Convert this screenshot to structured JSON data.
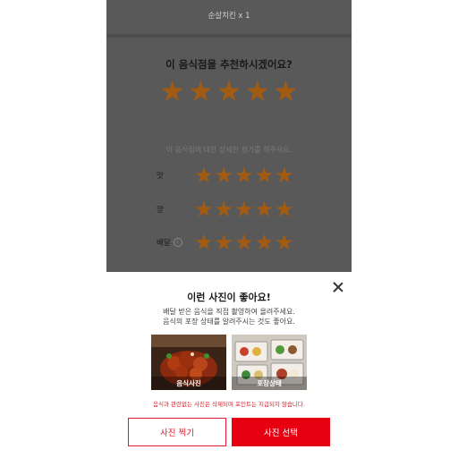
{
  "order": {
    "item_line": "순살치킨 x 1"
  },
  "rating": {
    "question": "이 음식점을 추천하시겠어요?",
    "overall_stars": 5,
    "detail_hint": "이 음식점에 대한 상세한 평가를 해주세요.",
    "categories": [
      {
        "label": "맛",
        "stars": 5,
        "info": false
      },
      {
        "label": "양",
        "stars": 5,
        "info": false
      },
      {
        "label": "배달",
        "stars": 5,
        "info": true
      }
    ],
    "star_color": "#a35b12"
  },
  "sheet": {
    "title": "이런 사진이 좋아요!",
    "desc_line1": "배달 받은 음식을 직접 촬영하여 올려주세요.",
    "desc_line2": "음식의 포장 상태를 알려주시는 것도 좋아요.",
    "photo1_caption": "음식사진",
    "photo2_caption": "포장상태",
    "warning": "음식과 관련없는 사진은 삭제되며 포인트는 지급되지 않습니다.",
    "btn_take": "사진 찍기",
    "btn_select": "사진 선택",
    "accent_color": "#e60012"
  }
}
